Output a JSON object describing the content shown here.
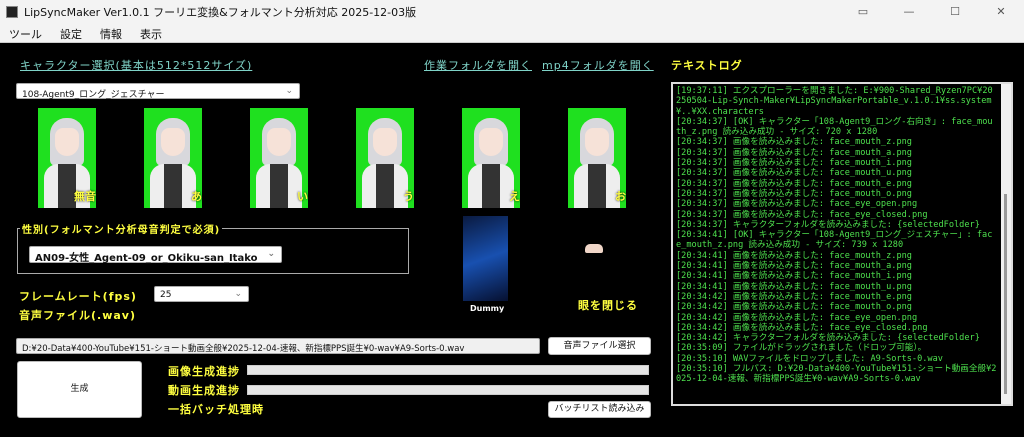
{
  "window": {
    "title": "LipSyncMaker Ver1.0.1 フーリエ変換&フォルマント分析対応 2025-12-03版"
  },
  "menu": [
    "ツール",
    "設定",
    "情報",
    "表示"
  ],
  "links": {
    "character_select": "キャラクター選択(基本は512*512サイズ)",
    "open_work_folder": "作業フォルダを開く",
    "open_mp4_folder": "mp4フォルダを開く"
  },
  "character_dropdown": "108-Agent9_ロング_ジェスチャー",
  "mouth_images": [
    "無音",
    "あ",
    "い",
    "う",
    "え",
    "お"
  ],
  "gender_group": {
    "label": "性別(フォルマント分析母音判定で必須)",
    "value": "AN09-女性_Agent-09_or_Okiku-san_Itako"
  },
  "framerate": {
    "label": "フレームレート(fps)",
    "value": "25"
  },
  "audio": {
    "label": "音声ファイル(.wav)",
    "path": "D:¥20-Data¥400-YouTube¥151-ショート動画全般¥2025-12-04-速報、新指標PPS誕生¥0-wav¥A9-Sorts-0.wav",
    "select_button": "音声ファイル選択"
  },
  "background": {
    "label": "Dummy"
  },
  "eye": {
    "label": "眼を閉じる"
  },
  "generate_button": "生成",
  "progress": {
    "image_label": "画像生成進捗",
    "image_value": 0,
    "video_label": "動画生成進捗",
    "video_value": 0
  },
  "batch": {
    "label": "一括バッチ処理時",
    "button": "バッチリスト読み込み"
  },
  "log": {
    "title": "テキストログ",
    "lines": [
      "[19:37:11] エクスプローラーを開きました: E:¥900-Shared_Ryzen7PC¥20250504-Lip-Synch-Maker¥LipSyncMakerPortable_v.1.0.1¥ss.system¥..¥XX.characters",
      "[20:34:37] [OK] キャラクター「108-Agent9_ロング-右向き」: face_mouth_z.png 読み込み成功 - サイズ: 720 x 1280",
      "[20:34:37] 画像を読み込みました: face_mouth_z.png",
      "[20:34:37] 画像を読み込みました: face_mouth_a.png",
      "[20:34:37] 画像を読み込みました: face_mouth_i.png",
      "[20:34:37] 画像を読み込みました: face_mouth_u.png",
      "[20:34:37] 画像を読み込みました: face_mouth_e.png",
      "[20:34:37] 画像を読み込みました: face_mouth_o.png",
      "[20:34:37] 画像を読み込みました: face_eye_open.png",
      "[20:34:37] 画像を読み込みました: face_eye_closed.png",
      "[20:34:37] キャラクターフォルダを読み込みました: {selectedFolder}",
      "[20:34:41] [OK] キャラクター「108-Agent9_ロング_ジェスチャー」: face_mouth_z.png 読み込み成功 - サイズ: 739 x 1280",
      "[20:34:41] 画像を読み込みました: face_mouth_z.png",
      "[20:34:41] 画像を読み込みました: face_mouth_a.png",
      "[20:34:41] 画像を読み込みました: face_mouth_i.png",
      "[20:34:41] 画像を読み込みました: face_mouth_u.png",
      "[20:34:42] 画像を読み込みました: face_mouth_e.png",
      "[20:34:42] 画像を読み込みました: face_mouth_o.png",
      "[20:34:42] 画像を読み込みました: face_eye_open.png",
      "[20:34:42] 画像を読み込みました: face_eye_closed.png",
      "[20:34:42] キャラクターフォルダを読み込みました: {selectedFolder}",
      "[20:35:09] ファイルがドラッグされました（ドロップ可能）。",
      "[20:35:10] WAVファイルをドロップしました: A9-Sorts-0.wav",
      "[20:35:10] フルパス: D:¥20-Data¥400-YouTube¥151-ショート動画全般¥2025-12-04-速報、新指標PPS誕生¥0-wav¥A9-Sorts-0.wav"
    ]
  }
}
